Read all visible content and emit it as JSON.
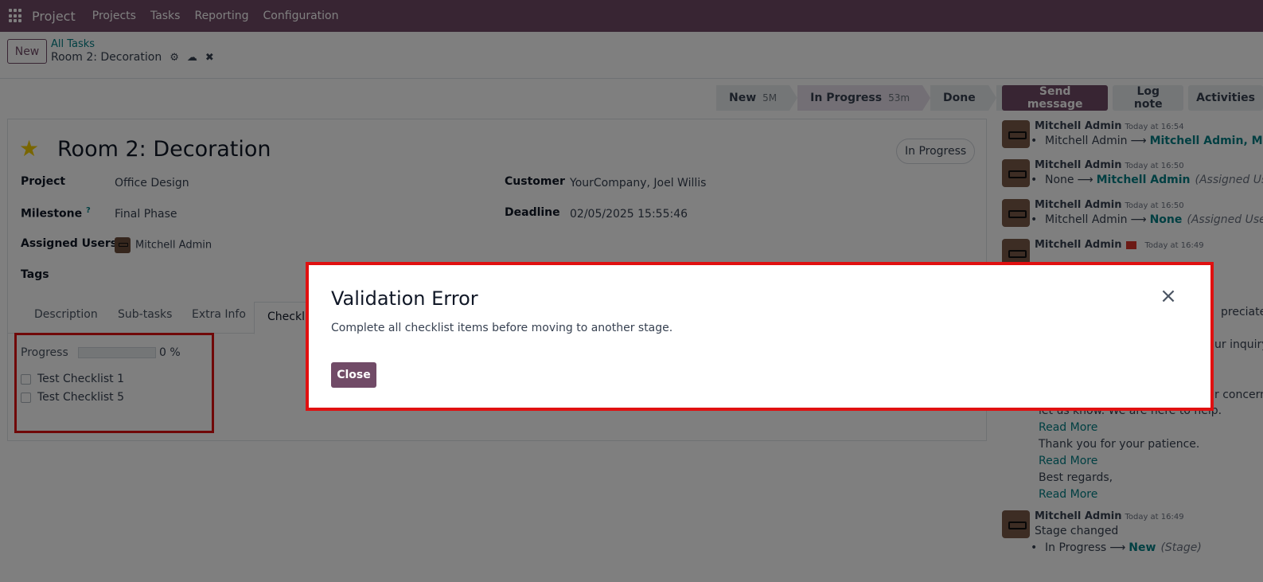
{
  "navbar": {
    "brand": "Project",
    "items": [
      "Projects",
      "Tasks",
      "Reporting",
      "Configuration"
    ]
  },
  "control": {
    "new_label": "New",
    "breadcrumb": "All Tasks",
    "record_name": "Room 2: Decoration"
  },
  "statusbar": {
    "stages": [
      {
        "label": "New",
        "count": "5M"
      },
      {
        "label": "In Progress",
        "count": "53m"
      },
      {
        "label": "Done",
        "count": ""
      },
      {
        "label": "...",
        "count": ""
      }
    ],
    "active_stage": "In Progress"
  },
  "form": {
    "title": "Room 2: Decoration",
    "state": "In Progress",
    "fields": {
      "project_label": "Project",
      "project_value": "Office Design",
      "milestone_label": "Milestone",
      "milestone_help": "?",
      "milestone_value": "Final Phase",
      "assigned_label": "Assigned Users",
      "assigned_value": "Mitchell Admin",
      "tags_label": "Tags",
      "customer_label": "Customer",
      "customer_value": "YourCompany, Joel Willis",
      "deadline_label": "Deadline",
      "deadline_value": "02/05/2025 15:55:46"
    },
    "tabs": [
      "Description",
      "Sub-tasks",
      "Extra Info",
      "Checklist"
    ],
    "active_tab": "Checklist",
    "checklist": {
      "progress_label": "Progress",
      "progress_percent": 0,
      "progress_text": "0 %",
      "items": [
        "Test Checklist 1",
        "Test Checklist 5"
      ]
    }
  },
  "chatter": {
    "buttons": [
      "Send message",
      "Log note",
      "Activities"
    ],
    "messages": [
      {
        "author": "Mitchell Admin",
        "time": "Today at 16:54",
        "old": "Mitchell Admin",
        "new": "Mitchell Admin, Mar",
        "field": ""
      },
      {
        "author": "Mitchell Admin",
        "time": "Today at 16:50",
        "old": "None",
        "new": "Mitchell Admin",
        "field": "(Assigned User"
      },
      {
        "author": "Mitchell Admin",
        "time": "Today at 16:50",
        "old": "Mitchell Admin",
        "new": "None",
        "field": "(Assigned User"
      },
      {
        "author": "Mitchell Admin",
        "time": "Today at 16:49"
      }
    ],
    "email_body": {
      "fragment_1": "preciate y",
      "fragment_2": "ur inquiry a",
      "fragment_3": "r concerns",
      "line_partial": "let us know. We are here to help.",
      "read_more": "Read More",
      "patience": "Thank you for your patience.",
      "regards": "Best regards,"
    },
    "stage_message": {
      "author": "Mitchell Admin",
      "time": "Today at 16:49",
      "text": "Stage changed",
      "old": "In Progress",
      "new": "New",
      "field": "(Stage)"
    }
  },
  "dialog": {
    "title": "Validation Error",
    "body": "Complete all checklist items before moving to another stage.",
    "close_label": "Close",
    "close_icon": "×"
  },
  "colors": {
    "brand": "#714b67",
    "link": "#017e84",
    "highlight": "#e01010"
  }
}
